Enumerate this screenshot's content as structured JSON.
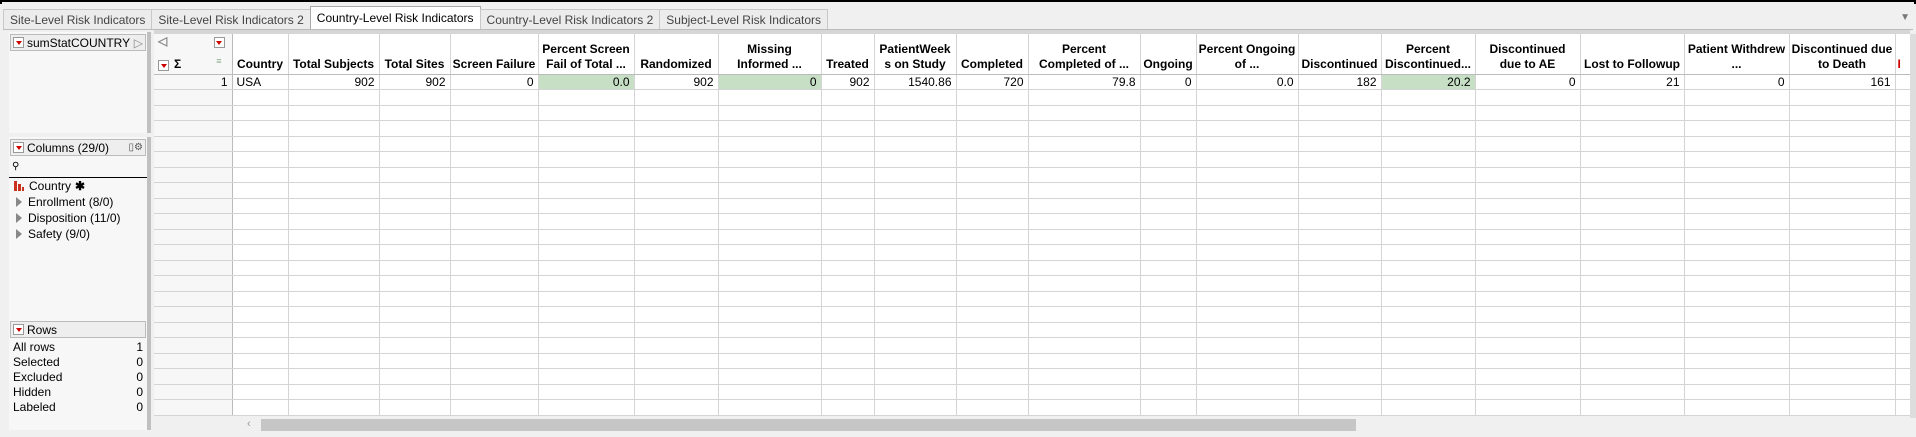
{
  "tabs": [
    "Site-Level Risk Indicators",
    "Site-Level Risk Indicators 2",
    "Country-Level Risk Indicators",
    "Country-Level Risk Indicators 2",
    "Subject-Level Risk Indicators"
  ],
  "active_tab": 2,
  "table_panel": {
    "name": "sumStatCOUNTRY"
  },
  "columns_panel": {
    "title": "Columns (29/0)",
    "items": [
      {
        "label": "Country",
        "marker": "✱"
      },
      {
        "label": "Enrollment (8/0)"
      },
      {
        "label": "Disposition (11/0)"
      },
      {
        "label": "Safety (9/0)"
      }
    ]
  },
  "rows_panel": {
    "title": "Rows",
    "items": [
      {
        "label": "All rows",
        "value": "1"
      },
      {
        "label": "Selected",
        "value": "0"
      },
      {
        "label": "Excluded",
        "value": "0"
      },
      {
        "label": "Hidden",
        "value": "0"
      },
      {
        "label": "Labeled",
        "value": "0"
      }
    ]
  },
  "grid": {
    "sigma": "Σ",
    "headers": [
      "Country",
      "Total Subjects",
      "Total Sites",
      "Screen Failure",
      "Percent Screen Fail of Total ...",
      "Randomized",
      "Missing Informed ...",
      "Treated",
      "PatientWeek s on Study",
      "Completed",
      "Percent Completed of ...",
      "Ongoing",
      "Percent Ongoing of ...",
      "Discontinued",
      "Percent Discontinued...",
      "Discontinued due to AE",
      "Lost to Followup",
      "Patient Withdrew ...",
      "Discontinued due to Death",
      "I"
    ],
    "rows": [
      {
        "num": "1",
        "cells": [
          "USA",
          "902",
          "902",
          "0",
          "0.0",
          "902",
          "0",
          "902",
          "1540.86",
          "720",
          "79.8",
          "0",
          "0.0",
          "182",
          "20.2",
          "0",
          "21",
          "0",
          "161",
          ""
        ]
      }
    ],
    "highlight_color": "#c6dfc5"
  }
}
